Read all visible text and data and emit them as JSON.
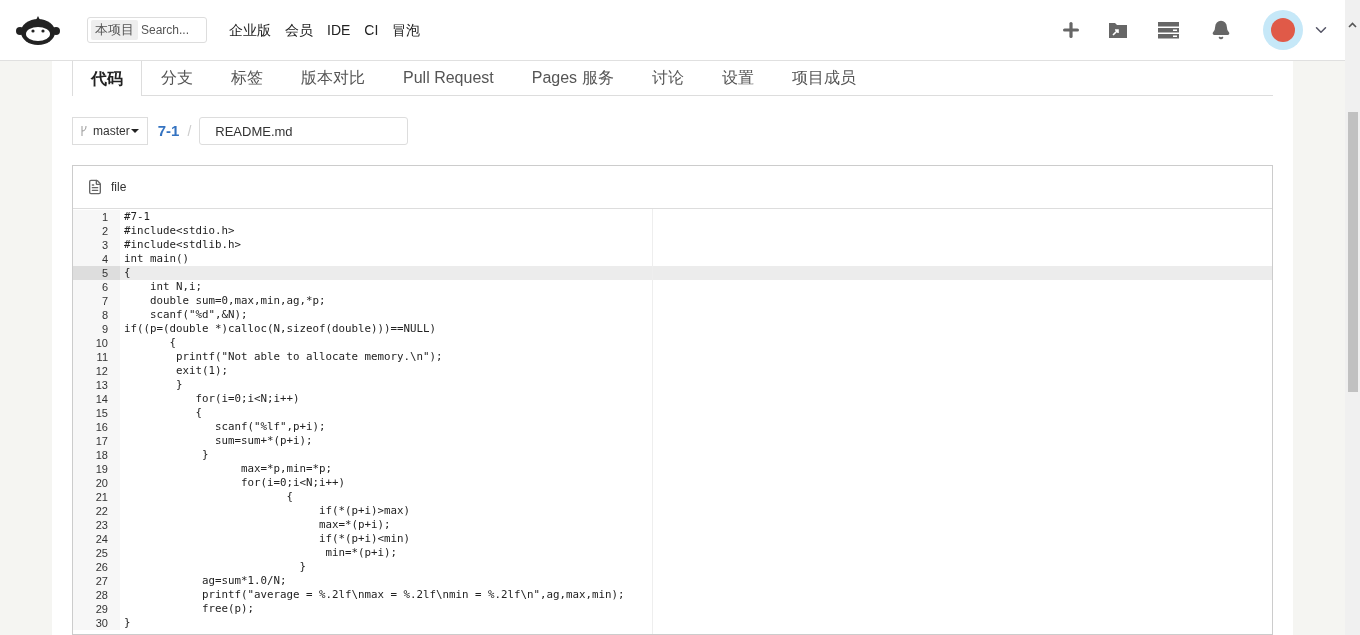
{
  "header": {
    "search": {
      "scope": "本项目",
      "placeholder": "Search..."
    },
    "nav": [
      "企业版",
      "会员",
      "IDE",
      "CI",
      "冒泡"
    ]
  },
  "tabs": [
    {
      "label": "代码",
      "selected": true
    },
    {
      "label": "分支",
      "selected": false
    },
    {
      "label": "标签",
      "selected": false
    },
    {
      "label": "版本对比",
      "selected": false
    },
    {
      "label": "Pull Request",
      "selected": false
    },
    {
      "label": "Pages 服务",
      "selected": false
    },
    {
      "label": "讨论",
      "selected": false
    },
    {
      "label": "设置",
      "selected": false
    },
    {
      "label": "项目成员",
      "selected": false
    }
  ],
  "breadcrumb": {
    "branch": "master",
    "project": "7-1",
    "separator": "/",
    "file_name": "README.md"
  },
  "file_panel": {
    "label": "file",
    "lines": [
      {
        "number": "1",
        "code": "#7-1",
        "selected": false
      },
      {
        "number": "2",
        "code": "#include<stdio.h>",
        "selected": false
      },
      {
        "number": "3",
        "code": "#include<stdlib.h>",
        "selected": false
      },
      {
        "number": "4",
        "code": "int main()",
        "selected": false
      },
      {
        "number": "5",
        "code": "{",
        "selected": true
      },
      {
        "number": "6",
        "code": "    int N,i;",
        "selected": false
      },
      {
        "number": "7",
        "code": "    double sum=0,max,min,ag,*p;",
        "selected": false
      },
      {
        "number": "8",
        "code": "    scanf(\"%d\",&N);",
        "selected": false
      },
      {
        "number": "9",
        "code": "if((p=(double *)calloc(N,sizeof(double)))==NULL)",
        "selected": false
      },
      {
        "number": "10",
        "code": "       {",
        "selected": false
      },
      {
        "number": "11",
        "code": "        printf(\"Not able to allocate memory.\\n\");",
        "selected": false
      },
      {
        "number": "12",
        "code": "        exit(1);",
        "selected": false
      },
      {
        "number": "13",
        "code": "        }",
        "selected": false
      },
      {
        "number": "14",
        "code": "           for(i=0;i<N;i++)",
        "selected": false
      },
      {
        "number": "15",
        "code": "           {",
        "selected": false
      },
      {
        "number": "16",
        "code": "              scanf(\"%lf\",p+i);",
        "selected": false
      },
      {
        "number": "17",
        "code": "              sum=sum+*(p+i);",
        "selected": false
      },
      {
        "number": "18",
        "code": "            }",
        "selected": false
      },
      {
        "number": "19",
        "code": "                  max=*p,min=*p;",
        "selected": false
      },
      {
        "number": "20",
        "code": "                  for(i=0;i<N;i++)",
        "selected": false
      },
      {
        "number": "21",
        "code": "                         {",
        "selected": false
      },
      {
        "number": "22",
        "code": "                              if(*(p+i)>max)",
        "selected": false
      },
      {
        "number": "23",
        "code": "                              max=*(p+i);",
        "selected": false
      },
      {
        "number": "24",
        "code": "                              if(*(p+i)<min)",
        "selected": false
      },
      {
        "number": "25",
        "code": "                               min=*(p+i);",
        "selected": false
      },
      {
        "number": "26",
        "code": "                           }",
        "selected": false
      },
      {
        "number": "27",
        "code": "            ag=sum*1.0/N;",
        "selected": false
      },
      {
        "number": "28",
        "code": "            printf(\"average = %.2lf\\nmax = %.2lf\\nmin = %.2lf\\n\",ag,max,min);",
        "selected": false
      },
      {
        "number": "29",
        "code": "            free(p);",
        "selected": false
      },
      {
        "number": "30",
        "code": "}",
        "selected": false
      }
    ]
  }
}
